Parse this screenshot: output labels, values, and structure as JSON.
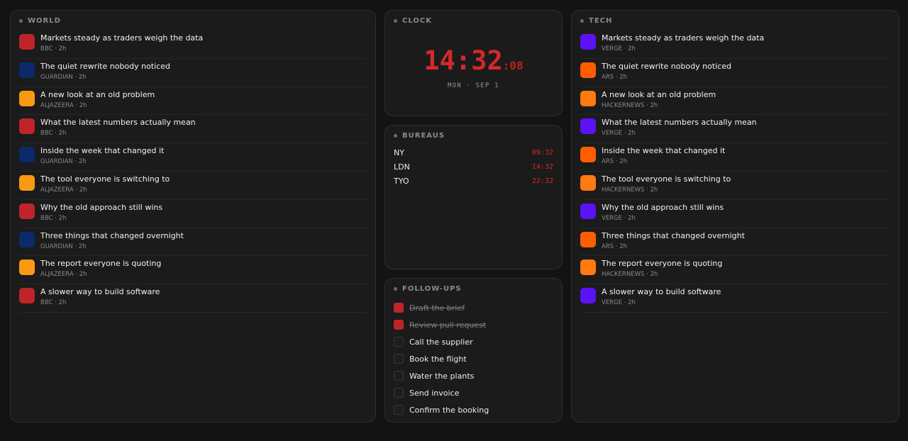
{
  "world": {
    "title": "WORLD",
    "items": [
      {
        "title": "Markets steady as traders weigh the data",
        "meta": "BBC · 2h",
        "color": "#c0242b"
      },
      {
        "title": "The quiet rewrite nobody noticed",
        "meta": "GUARDIAN · 2h",
        "color": "#0a2a6b"
      },
      {
        "title": "A new look at an old problem",
        "meta": "ALJAZEERA · 2h",
        "color": "#fa9a12"
      },
      {
        "title": "What the latest numbers actually mean",
        "meta": "BBC · 2h",
        "color": "#c0242b"
      },
      {
        "title": "Inside the week that changed it",
        "meta": "GUARDIAN · 2h",
        "color": "#0a2a6b"
      },
      {
        "title": "The tool everyone is switching to",
        "meta": "ALJAZEERA · 2h",
        "color": "#fa9a12"
      },
      {
        "title": "Why the old approach still wins",
        "meta": "BBC · 2h",
        "color": "#c0242b"
      },
      {
        "title": "Three things that changed overnight",
        "meta": "GUARDIAN · 2h",
        "color": "#0a2a6b"
      },
      {
        "title": "The report everyone is quoting",
        "meta": "ALJAZEERA · 2h",
        "color": "#fa9a12"
      },
      {
        "title": "A slower way to build software",
        "meta": "BBC · 2h",
        "color": "#c0242b"
      }
    ]
  },
  "clock": {
    "title": "CLOCK",
    "hm": "14:32",
    "sec": ":08",
    "date": "MON · SEP 1"
  },
  "bureaus": {
    "title": "BUREAUS",
    "rows": [
      {
        "city": "NY",
        "time": "09:32"
      },
      {
        "city": "LDN",
        "time": "14:32"
      },
      {
        "city": "TYO",
        "time": "22:32"
      }
    ]
  },
  "followups": {
    "title": "FOLLOW-UPS",
    "items": [
      {
        "label": "Draft the brief",
        "done": true
      },
      {
        "label": "Review pull request",
        "done": true
      },
      {
        "label": "Call the supplier",
        "done": false
      },
      {
        "label": "Book the flight",
        "done": false
      },
      {
        "label": "Water the plants",
        "done": false
      },
      {
        "label": "Send invoice",
        "done": false
      },
      {
        "label": "Confirm the booking",
        "done": false
      }
    ]
  },
  "tech": {
    "title": "TECH",
    "items": [
      {
        "title": "Markets steady as traders weigh the data",
        "meta": "VERGE · 2h",
        "color": "#5b12f5"
      },
      {
        "title": "The quiet rewrite nobody noticed",
        "meta": "ARS · 2h",
        "color": "#ff5e00"
      },
      {
        "title": "A new look at an old problem",
        "meta": "HACKERNEWS · 2h",
        "color": "#ff7a10"
      },
      {
        "title": "What the latest numbers actually mean",
        "meta": "VERGE · 2h",
        "color": "#5b12f5"
      },
      {
        "title": "Inside the week that changed it",
        "meta": "ARS · 2h",
        "color": "#ff5e00"
      },
      {
        "title": "The tool everyone is switching to",
        "meta": "HACKERNEWS · 2h",
        "color": "#ff7a10"
      },
      {
        "title": "Why the old approach still wins",
        "meta": "VERGE · 2h",
        "color": "#5b12f5"
      },
      {
        "title": "Three things that changed overnight",
        "meta": "ARS · 2h",
        "color": "#ff5e00"
      },
      {
        "title": "The report everyone is quoting",
        "meta": "HACKERNEWS · 2h",
        "color": "#ff7a10"
      },
      {
        "title": "A slower way to build software",
        "meta": "VERGE · 2h",
        "color": "#5b12f5"
      }
    ]
  }
}
